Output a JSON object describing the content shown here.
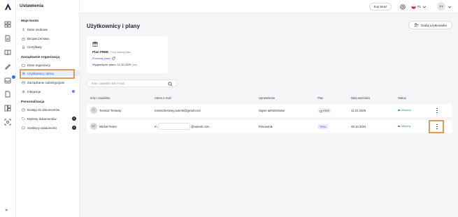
{
  "sidebar": {
    "title": "Ustawienia",
    "sections": [
      {
        "label": "Moje konto",
        "items": [
          "Dane osobowe",
          "Bezpieczeństwo",
          "Certyfikaty"
        ]
      },
      {
        "label": "Zarządzanie organizacją",
        "items": [
          "Dane organizacji",
          "Użytkownicy i plany",
          "Zarządzanie subskrypcjami",
          "Integracje"
        ]
      },
      {
        "label": "Personalizacja",
        "items": [
          "Dostęp do dokumentów",
          "Etykiety dokumentów",
          "Szablony wiadomości"
        ]
      }
    ],
    "counts": {
      "etykiety": "0",
      "szablony": "0"
    }
  },
  "topbar": {
    "buy_label": "Kup teraz",
    "language": "PL",
    "avatar_initials": "TT"
  },
  "main": {
    "title": "Użytkownicy i plany",
    "add_user_label": "Dodaj użytkownika",
    "plan": {
      "name": "Plan FREE",
      "name_note": "(Twój obecny plan)",
      "compare_link": "Porównaj plany",
      "expiry": "Wygaśnięcie planu: 11.10.2025",
      "expiry_note": "(rok)"
    },
    "search_placeholder": "Imię, nazwisko lub e-mail",
    "columns": [
      "Imię i nazwisko",
      "Adres e-mail",
      "Uprawnienie",
      "Plan",
      "Data ważności",
      "Status"
    ],
    "rows": [
      {
        "initials": "TT",
        "name": "Tomasz Testowy",
        "email": "tomasztestowy.autenti@gmail.com",
        "role": "Super administrator",
        "plan": "FREE",
        "expiry": "11.10.2025",
        "status": "Aktywny"
      },
      {
        "initials": "MT",
        "name": "Michał Tester",
        "email_start": "m",
        "email_end": "@autenti.com",
        "role": "Pracownik",
        "plan": "TRIAL",
        "expiry": "28.10.2024",
        "status": "Aktywny"
      }
    ]
  },
  "colors": {
    "accent": "#2b5ce6",
    "highlight": "#e39a55",
    "active_status": "#2b9a55"
  }
}
